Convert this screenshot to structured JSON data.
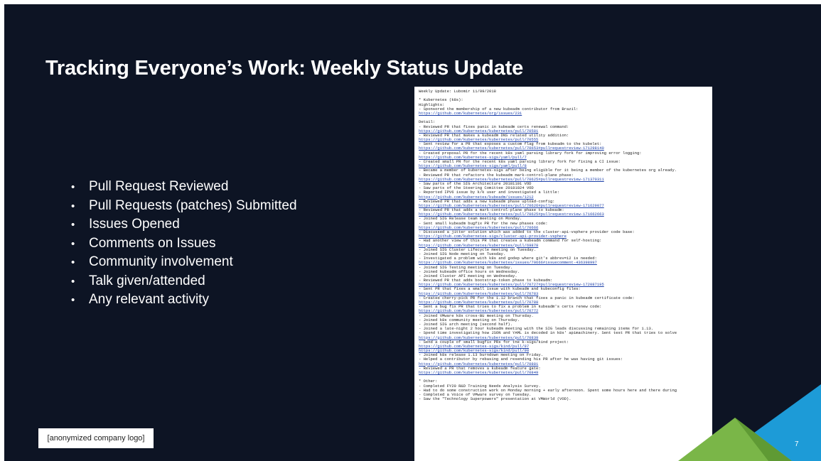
{
  "slide": {
    "title": "Tracking Everyone’s Work: Weekly Status Update",
    "bullet_glyph": "•",
    "bullets": [
      "Pull Request Reviewed",
      "Pull Requests (patches) Submitted",
      "Issues Opened",
      "Comments on Issues",
      "Community involvement",
      "Talk given/attended",
      "Any relevant activity"
    ],
    "logo_text": "[anonymized company logo]",
    "page_number": "7",
    "colors": {
      "background": "#0d1424",
      "accent_green": "#7ab648",
      "accent_blue": "#1d9bd7",
      "link": "#1a3ea8"
    }
  },
  "document": {
    "lines": [
      {
        "t": "Weekly Update: Lubomir 11/09/2018",
        "k": "text"
      },
      {
        "t": "",
        "k": "blank"
      },
      {
        "t": "* Kubernetes (k8s):",
        "k": "text"
      },
      {
        "t": "Highlights:",
        "k": "text"
      },
      {
        "t": "- Sponsored the membership of a new kubeadm contributor from Brazil:",
        "k": "text"
      },
      {
        "t": "https://github.com/kubernetes/org/issues/231",
        "k": "link"
      },
      {
        "t": "",
        "k": "blank"
      },
      {
        "t": "Detail:",
        "k": "text"
      },
      {
        "t": "- Reviewed PR that fixes panic in kubeadm certs renewal command:",
        "k": "text"
      },
      {
        "t": "https://github.com/kubernetes/kubernetes/pull/70581",
        "k": "link"
      },
      {
        "t": "- Reviewed PR that makes a kubeadm DNS related utility addition:",
        "k": "text"
      },
      {
        "t": "https://github.com/kubernetes/kubernetes/pull/70555",
        "k": "link"
      },
      {
        "t": "- Sent review for a PR that exposes a custom flag from kubeadm to the kubelet:",
        "k": "text"
      },
      {
        "t": "https://github.com/kubernetes/kubernetes/pull/70653#pullrequestreview-171298140",
        "k": "link"
      },
      {
        "t": "- Created proposal PR for the recent k8s yaml parsing library fork for improving error logging:",
        "k": "text"
      },
      {
        "t": "https://github.com/kubernetes-sigs/yaml/pull/7",
        "k": "link"
      },
      {
        "t": "- Created small PR for the recent k8s yaml parsing library fork for fixing a CI issue:",
        "k": "text"
      },
      {
        "t": "https://github.com/kubernetes-sigs/yaml/pull/8",
        "k": "link"
      },
      {
        "t": "- Became a member of kubernetes-sigs after being eligible for it being a member of the kubernetes org already.",
        "k": "text"
      },
      {
        "t": "- Reviewed PR that refactors the kubeadm mark-control-plane phase:",
        "k": "text"
      },
      {
        "t": "https://github.com/kubernetes/kubernetes/pull/70625#pullrequestreview-171370311",
        "k": "link"
      },
      {
        "t": "- Saw parts of the SIG Architecture 20181101 VOD",
        "k": "text"
      },
      {
        "t": "- Saw parts of the Steering Comittee 20181024 VOD",
        "k": "text"
      },
      {
        "t": "- Reported IPV6 issue by k/k user and investigated a little:",
        "k": "text"
      },
      {
        "t": "https://github.com/kubernetes/kubeadm/issues/1212",
        "k": "link"
      },
      {
        "t": "- Reviewed PR that adds a new kubeadm phase upload-config:",
        "k": "text"
      },
      {
        "t": "https://github.com/kubernetes/kubernetes/pull/70626#pullrequestreview-171629077",
        "k": "link"
      },
      {
        "t": "- Reviewed PR that adds a mark-control-plane phase to kubeadm:",
        "k": "text"
      },
      {
        "t": "https://github.com/kubernetes/kubernetes/pull/70625#pullrequestreview-171662663",
        "k": "link"
      },
      {
        "t": "- Joined SIG Release team meeting on Monday.",
        "k": "text"
      },
      {
        "t": "- Sent small kubeadm bugfix PR for the new phases code:",
        "k": "text"
      },
      {
        "t": "https://github.com/kubernetes/kubernetes/pull/70666",
        "k": "link"
      },
      {
        "t": "- Discussed a jitter solution which was added to the cluster-api-vsphere provider code base:",
        "k": "text"
      },
      {
        "t": "https://github.com/kubernetes-sigs/cluster-api-provider-vsphere",
        "k": "link"
      },
      {
        "t": "- Had another view of this PR that creates a kubeadm command for self-hosting:",
        "k": "text"
      },
      {
        "t": "https://github.com/kubernetes/kubernetes/pull/69878",
        "k": "link"
      },
      {
        "t": "- Joined SIG Cluster Lifecycle meeting on Tuesday.",
        "k": "text"
      },
      {
        "t": "- Joined SIG Node meeting on Tuesday.",
        "k": "text"
      },
      {
        "t": "- Investigated a problem with k8s and godep where git's abbrev=12 is needed:",
        "k": "text"
      },
      {
        "t": "https://github.com/kubernetes/kubernetes/issues/70666#issuecomment-436398997",
        "k": "link"
      },
      {
        "t": "- Joined SIG Testing meeting on Tuesday.",
        "k": "text"
      },
      {
        "t": "- Joined kubeadm office hours on Wednesday.",
        "k": "text"
      },
      {
        "t": "- Joined Cluster API meeting on Wednesday.",
        "k": "text"
      },
      {
        "t": "- Reviewed PR that adds bootstrap-token phase to kubeadm:",
        "k": "text"
      },
      {
        "t": "https://github.com/kubernetes/kubernetes/pull/70727#pullrequestreview-172087195",
        "k": "link"
      },
      {
        "t": "- Sent PR that fixes a small issue with kubeadm and kubeconfig files:",
        "k": "text"
      },
      {
        "t": "https://github.com/kubernetes/kubernetes/pull/70783",
        "k": "link"
      },
      {
        "t": "- Created cherry-pick PR for the 1.12 branch that fixes a panic in kubeadm certificate code:",
        "k": "text"
      },
      {
        "t": "https://github.com/kubernetes/kubernetes/pull/70788",
        "k": "link"
      },
      {
        "t": "- Sent a bug fix PR that tries to fix a problem in kubeadm's certs renew code:",
        "k": "text"
      },
      {
        "t": "https://github.com/kubernetes/kubernetes/pull/70772",
        "k": "link"
      },
      {
        "t": "- Joined VMware k8s cross-BU meeting on Thursday.",
        "k": "text"
      },
      {
        "t": "- Joined k8s community meeting on Thursday.",
        "k": "text"
      },
      {
        "t": "- Joined SIG arch meeting (second half).",
        "k": "text"
      },
      {
        "t": "- Joined a late-night 2 hour kubeadm meeting with the SIG leads discussing remaining items for 1.13.",
        "k": "text"
      },
      {
        "t": "- Spend time investigating how JSON and YAML is decoded in k8s' apimachinery. Sent test PR that tries to solve",
        "k": "text"
      },
      {
        "t": "https://github.com/kubernetes/kubernetes/pull/70839",
        "k": "link"
      },
      {
        "t": "- Send a couple of small bugfix PRs for the k-sigs/kind project:",
        "k": "text"
      },
      {
        "t": "https://github.com/kubernetes-sigs/kind/pull/97",
        "k": "link"
      },
      {
        "t": "https://github.com/kubernetes-sigs/kind/pull/98",
        "k": "link"
      },
      {
        "t": "- Joined k8s release 1.13 burndown meeting on Friday.",
        "k": "text"
      },
      {
        "t": "- Helped a contributor by rebasing and resending his PR after he was having git issues:",
        "k": "text"
      },
      {
        "t": "https://github.com/kubernetes/kubernetes/pull/70881",
        "k": "link"
      },
      {
        "t": "- Reviewed a PR that removes a kubeadm feature gate:",
        "k": "text"
      },
      {
        "t": "https://github.com/kubernetes/kubernetes/pull/70849",
        "k": "link"
      },
      {
        "t": "",
        "k": "blank"
      },
      {
        "t": "* Other:",
        "k": "text"
      },
      {
        "t": "- Completed FY20 R&D Training Needs Analysis Survey.",
        "k": "text"
      },
      {
        "t": "- Had to do some construction work on Monday morning + early afternoon. Spent some hours here and there during",
        "k": "text"
      },
      {
        "t": "- Completed a Voice of VMware survey on Tuesday.",
        "k": "text"
      },
      {
        "t": "- Saw the \"Technology Superpowers\" presentation at VMWorld (VOD).",
        "k": "text"
      }
    ]
  }
}
